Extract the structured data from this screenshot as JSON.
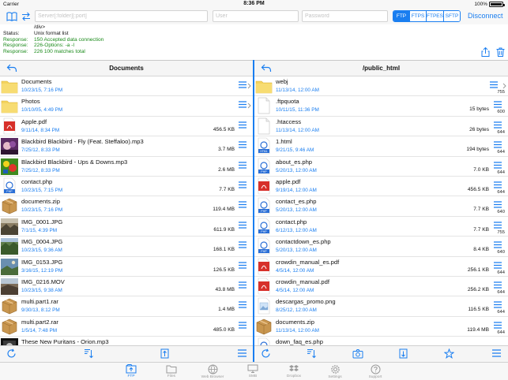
{
  "status_bar": {
    "carrier": "Carrier",
    "time": "8:36 PM",
    "battery": "100%"
  },
  "connection": {
    "server_placeholder": "Server[:folder][:port]",
    "user_placeholder": "User",
    "password_placeholder": "Password",
    "protocols": [
      "FTP",
      "FTPS",
      "FTPES",
      "SFTP"
    ],
    "active_protocol": "FTP",
    "disconnect_label": "Disconnect"
  },
  "log": [
    {
      "label": "",
      "text": "/div>",
      "color": "black"
    },
    {
      "label": "Status:",
      "text": "Unix format list",
      "color": "black"
    },
    {
      "label": "Response:",
      "text": "150 Accepted data connection",
      "color": "green"
    },
    {
      "label": "Response:",
      "text": "226-Options: -a -l",
      "color": "green"
    },
    {
      "label": "Response:",
      "text": "226 100 matches total",
      "color": "green"
    }
  ],
  "left_pane": {
    "title": "Documents",
    "items": [
      {
        "name": "Documents",
        "date": "10/23/15, 7:16 PM",
        "size": "",
        "type": "folder"
      },
      {
        "name": "Photos",
        "date": "10/10/05, 4:49 PM",
        "size": "",
        "type": "folder"
      },
      {
        "name": "Apple.pdf",
        "date": "9/11/14, 8:34 PM",
        "size": "456.5 KB",
        "type": "pdf"
      },
      {
        "name": "Blackbird Blackbird - Fly (Feat. Steffaloo).mp3",
        "date": "7/25/12, 8:33 PM",
        "size": "3.7 MB",
        "type": "art1"
      },
      {
        "name": "Blackbird Blackbird - Ups & Downs.mp3",
        "date": "7/25/12, 8:33 PM",
        "size": "2.6 MB",
        "type": "art2"
      },
      {
        "name": "contact.php",
        "date": "10/23/15, 7:15 PM",
        "size": "7.7 KB",
        "type": "php"
      },
      {
        "name": "documents.zip",
        "date": "10/23/15, 7:16 PM",
        "size": "119.4 MB",
        "type": "zip"
      },
      {
        "name": "IMG_0001.JPG",
        "date": "7/1/15, 4:39 PM",
        "size": "611.9 KB",
        "type": "photo1"
      },
      {
        "name": "IMG_0004.JPG",
        "date": "10/23/15, 9:36 AM",
        "size": "168.1 KB",
        "type": "photo2"
      },
      {
        "name": "IMG_0153.JPG",
        "date": "3/16/15, 12:19 PM",
        "size": "126.5 KB",
        "type": "photo3"
      },
      {
        "name": "IMG_0216.MOV",
        "date": "10/23/15, 9:38 AM",
        "size": "43.8 MB",
        "type": "video"
      },
      {
        "name": "multi.part1.rar",
        "date": "9/30/13, 8:12 PM",
        "size": "1.4 MB",
        "type": "zip"
      },
      {
        "name": "multi.part2.rar",
        "date": "1/5/14, 7:48 PM",
        "size": "485.0 KB",
        "type": "zip"
      },
      {
        "name": "These New Puritans - Orion.mp3",
        "date": "",
        "size": "",
        "type": "art3"
      }
    ]
  },
  "right_pane": {
    "title": "/public_html",
    "items": [
      {
        "name": "webj",
        "date": "11/13/14, 12:00 AM",
        "size": "",
        "perm": "755",
        "type": "folder"
      },
      {
        "name": ".ftpquota",
        "date": "10/11/15, 11:36 PM",
        "size": "15 bytes",
        "perm": "600",
        "type": "doc"
      },
      {
        "name": ".htaccess",
        "date": "11/13/14, 12:00 AM",
        "size": "26 bytes",
        "perm": "644",
        "type": "doc"
      },
      {
        "name": "1.html",
        "date": "9/21/15, 9:46 AM",
        "size": "194 bytes",
        "perm": "644",
        "type": "html"
      },
      {
        "name": "about_es.php",
        "date": "5/20/13, 12:00 AM",
        "size": "7.0 KB",
        "perm": "644",
        "type": "php"
      },
      {
        "name": "apple.pdf",
        "date": "9/19/14, 12:00 AM",
        "size": "456.5 KB",
        "perm": "644",
        "type": "pdf"
      },
      {
        "name": "contact_es.php",
        "date": "5/20/13, 12:00 AM",
        "size": "7.7 KB",
        "perm": "640",
        "type": "php"
      },
      {
        "name": "contact.php",
        "date": "6/12/13, 12:00 AM",
        "size": "7.7 KB",
        "perm": "755",
        "type": "php"
      },
      {
        "name": "contactdown_es.php",
        "date": "5/20/13, 12:00 AM",
        "size": "8.4 KB",
        "perm": "640",
        "type": "php"
      },
      {
        "name": "crowdin_manual_es.pdf",
        "date": "4/5/14, 12:00 AM",
        "size": "256.1 KB",
        "perm": "644",
        "type": "pdf"
      },
      {
        "name": "crowdin_manual.pdf",
        "date": "4/5/14, 12:00 AM",
        "size": "256.2 KB",
        "perm": "644",
        "type": "pdf"
      },
      {
        "name": "descargas_promo.png",
        "date": "8/25/12, 12:00 AM",
        "size": "116.5 KB",
        "perm": "644",
        "type": "png"
      },
      {
        "name": "documents.zip",
        "date": "11/13/14, 12:00 AM",
        "size": "119.4 MB",
        "perm": "644",
        "type": "zip"
      },
      {
        "name": "down_faq_es.php",
        "date": "",
        "size": "",
        "perm": "",
        "type": "php"
      }
    ]
  },
  "tabs": [
    {
      "label": "FTP",
      "icon": "ftp-icon",
      "active": true
    },
    {
      "label": "Files",
      "icon": "files-icon",
      "active": false
    },
    {
      "label": "Web Browser",
      "icon": "globe-icon",
      "active": false
    },
    {
      "label": "SMB",
      "icon": "smb-icon",
      "active": false
    },
    {
      "label": "Dropbox",
      "icon": "dropbox-icon",
      "active": false
    },
    {
      "label": "Settings",
      "icon": "gear-icon",
      "active": false
    },
    {
      "label": "Support",
      "icon": "help-icon",
      "active": false
    }
  ],
  "colors": {
    "accent": "#1a7ef0",
    "response_green": "#1a8a1a",
    "folder_yellow": "#f4d35e"
  }
}
